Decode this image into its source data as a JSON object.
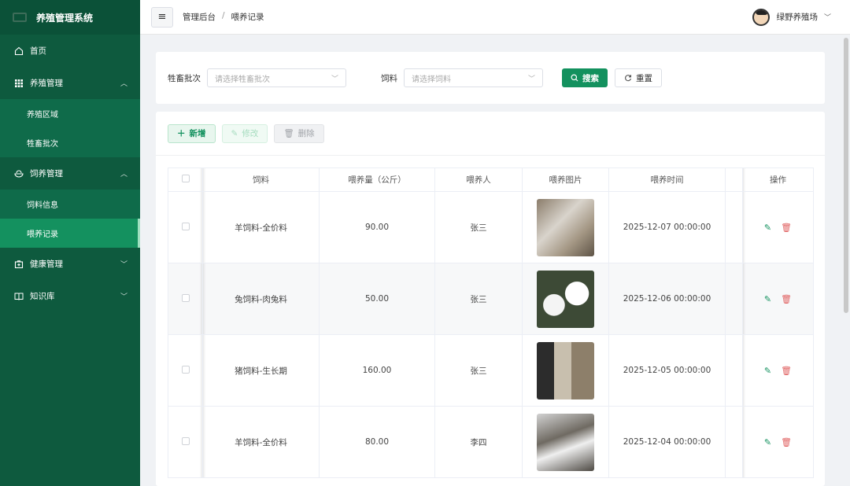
{
  "app": {
    "title": "养殖管理系统"
  },
  "sidebar": {
    "items": [
      {
        "label": "首页"
      },
      {
        "label": "养殖管理",
        "children": [
          {
            "label": "养殖区域"
          },
          {
            "label": "牲畜批次"
          }
        ]
      },
      {
        "label": "饲养管理",
        "children": [
          {
            "label": "饲料信息"
          },
          {
            "label": "喂养记录"
          }
        ]
      },
      {
        "label": "健康管理"
      },
      {
        "label": "知识库"
      }
    ]
  },
  "header": {
    "breadcrumb": [
      "管理后台",
      "/",
      "喂养记录"
    ],
    "user_name": "绿野养殖场"
  },
  "search": {
    "batch_label": "牲畜批次",
    "batch_placeholder": "请选择牲畜批次",
    "feed_label": "饲料",
    "feed_placeholder": "请选择饲料",
    "search_button": "搜索",
    "reset_button": "重置"
  },
  "toolbar": {
    "add": "新增",
    "edit": "修改",
    "delete": "删除"
  },
  "table": {
    "columns": [
      "饲料",
      "喂养量（公斤）",
      "喂养人",
      "喂养图片",
      "喂养时间",
      "操作"
    ],
    "rows": [
      {
        "feed": "羊饲料-全价料",
        "amount": "90.00",
        "person": "张三",
        "time": "2025-12-07 00:00:00"
      },
      {
        "feed": "兔饲料-肉兔料",
        "amount": "50.00",
        "person": "张三",
        "time": "2025-12-06 00:00:00"
      },
      {
        "feed": "猪饲料-生长期",
        "amount": "160.00",
        "person": "张三",
        "time": "2025-12-05 00:00:00"
      },
      {
        "feed": "羊饲料-全价料",
        "amount": "80.00",
        "person": "李四",
        "time": "2025-12-04 00:00:00"
      }
    ]
  },
  "colors": {
    "sidebar": "#0e5a3e",
    "primary": "#13915e",
    "danger": "#e06060"
  }
}
